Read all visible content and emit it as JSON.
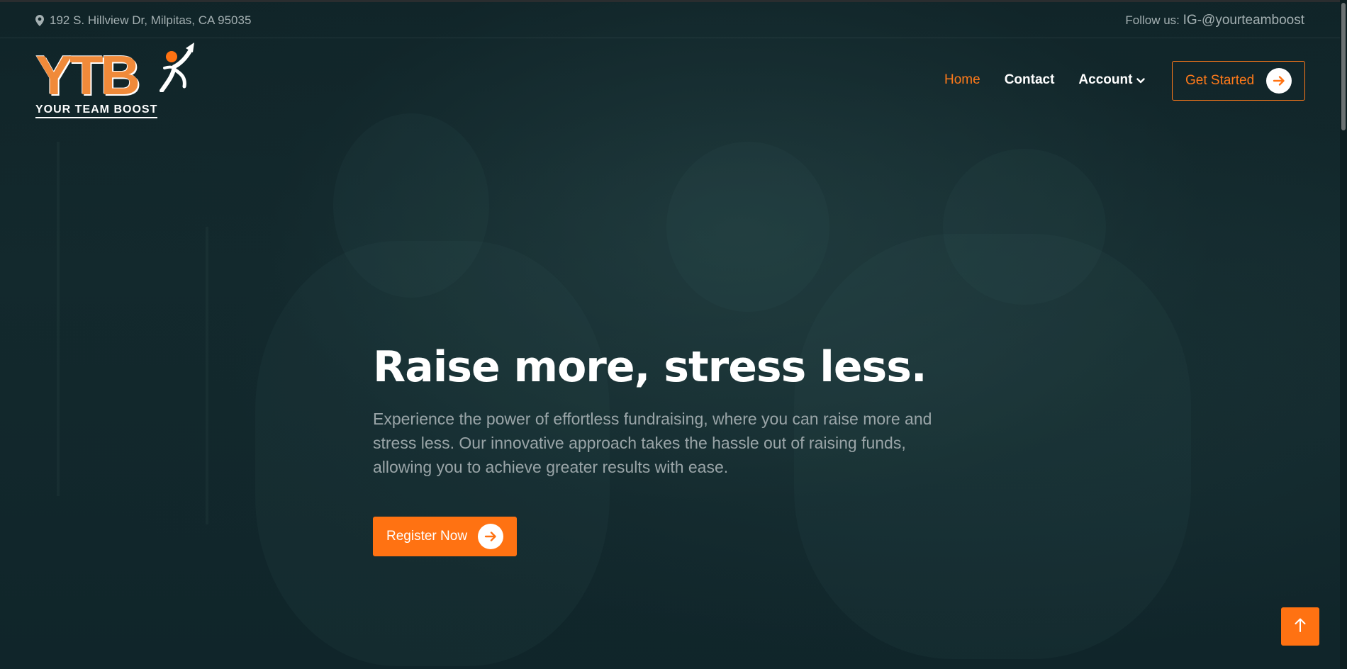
{
  "topbar": {
    "address": "192 S. Hillview Dr, Milpitas, CA 95035",
    "follow_label": "Follow us:",
    "follow_handle": "IG-@yourteamboost"
  },
  "logo": {
    "letters": "YTB",
    "tagline": "YOUR TEAM BOOST"
  },
  "nav": {
    "items": [
      {
        "label": "Home",
        "active": true
      },
      {
        "label": "Contact",
        "active": false
      },
      {
        "label": "Account",
        "active": false,
        "has_dropdown": true
      }
    ],
    "cta_label": "Get Started"
  },
  "hero": {
    "title": "Raise more, stress less.",
    "description": "Experience the power of effortless fundraising, where you can raise more and stress less. Our innovative approach takes the hassle out of raising funds, allowing you to achieve greater results with ease.",
    "button_label": "Register Now"
  },
  "colors": {
    "accent": "#ff7212",
    "background": "#102428",
    "text": "#ffffff",
    "muted_text": "#9aa5a8"
  },
  "icons": {
    "address": "map-pin-icon",
    "cta_arrow": "arrow-right-icon",
    "dropdown": "chevron-down-icon",
    "scroll_top": "arrow-up-icon"
  }
}
